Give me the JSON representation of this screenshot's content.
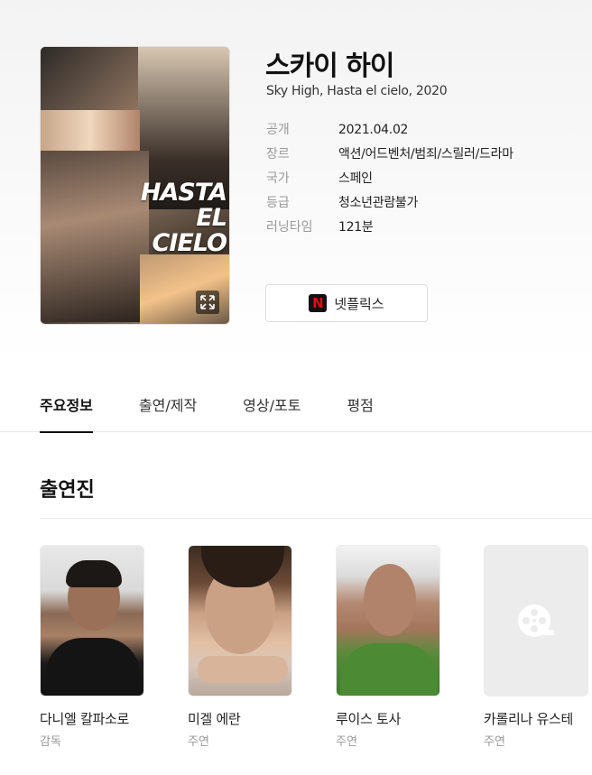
{
  "movie": {
    "title": "스카이 하이",
    "subtitle": "Sky High, Hasta el cielo, 2020",
    "poster": {
      "title_text": "HASTA EL CIELO",
      "expand_icon": "expand-icon"
    },
    "meta": [
      {
        "label": "공개",
        "value": "2021.04.02"
      },
      {
        "label": "장르",
        "value": "액션/어드벤처/범죄/스릴러/드라마"
      },
      {
        "label": "국가",
        "value": "스페인"
      },
      {
        "label": "등급",
        "value": "청소년관람불가"
      },
      {
        "label": "러닝타임",
        "value": "121분"
      }
    ],
    "streaming": {
      "label": "넷플릭스",
      "logo_letter": "N",
      "icon": "netflix-logo-icon"
    }
  },
  "tabs": [
    {
      "label": "주요정보",
      "active": true
    },
    {
      "label": "출연/제작",
      "active": false
    },
    {
      "label": "영상/포토",
      "active": false
    },
    {
      "label": "평점",
      "active": false
    }
  ],
  "cast_section": {
    "title": "출연진",
    "people": [
      {
        "name": "다니엘 칼파소로",
        "role": "감독"
      },
      {
        "name": "미겔 에란",
        "role": "주연"
      },
      {
        "name": "루이스 토사",
        "role": "주연"
      },
      {
        "name": "카롤리나 유스테",
        "role": "주연",
        "placeholder_icon": "film-reel-icon"
      }
    ]
  },
  "colors": {
    "netflix_red": "#e50914",
    "label_gray": "#999999",
    "active_tab": "#111111"
  }
}
